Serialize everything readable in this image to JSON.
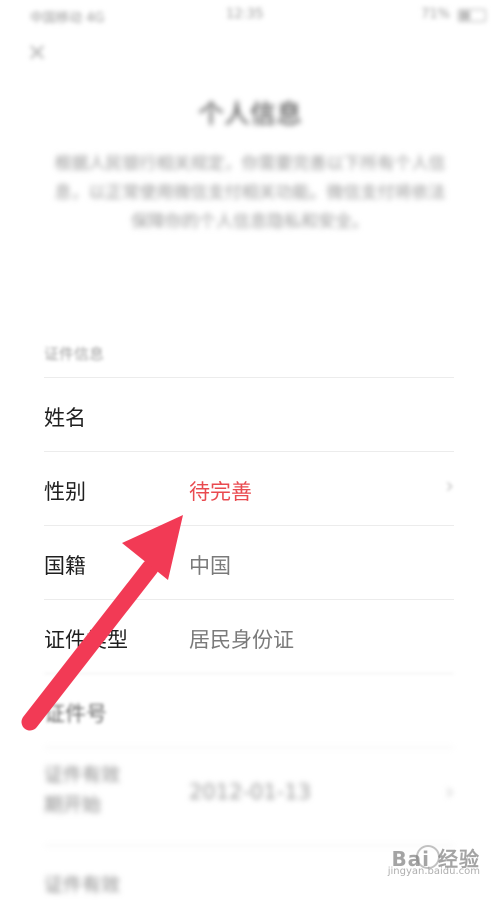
{
  "status_bar": {
    "carrier": "中国移动  4G",
    "time": "12:35",
    "battery": "71%"
  },
  "header": {
    "close_icon": "close-icon",
    "title": "个人信息",
    "description": "根据人民银行相关规定，你需要完善以下所有个人信息，以正常使用微信支付相关功能。微信支付将依法保障你的个人信息隐私和安全。"
  },
  "section": {
    "label": "证件信息",
    "rows": [
      {
        "label": "姓名",
        "value": ""
      },
      {
        "label": "性别",
        "value": "待完善",
        "value_color": "#e94a4f",
        "chevron": "›"
      },
      {
        "label": "国籍",
        "value": "中国"
      },
      {
        "label": "证件类型",
        "value": "居民身份证"
      },
      {
        "label": "证件号",
        "value": ""
      },
      {
        "label": "证件有效期开始",
        "value": "2012-01-13",
        "chevron": "›"
      },
      {
        "label": "证件有效",
        "value": ""
      }
    ]
  },
  "annotation": {
    "arrow_color": "#f23a55"
  },
  "watermark": {
    "text": "Bai 经验",
    "subtext": "jingyan.baidu.com"
  }
}
